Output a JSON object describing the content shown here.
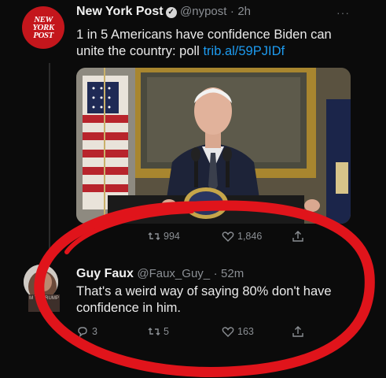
{
  "tweet1": {
    "avatar_text": [
      "NEW",
      "YORK",
      "POST"
    ],
    "name": "New York Post",
    "handle": "@nypost",
    "separator": "·",
    "time": "2h",
    "text": "1 in 5 Americans have confidence Biden can unite the country: poll",
    "link": "trib.al/59PJIDf",
    "more": "···",
    "metrics": {
      "retweets": "994",
      "likes": "1,846"
    }
  },
  "tweet2": {
    "avatar_badge": "M TO TRUMP",
    "name": "Guy Faux",
    "handle": "@Faux_Guy_",
    "separator": "·",
    "time": "52m",
    "text": "That's a weird way of saying 80% don't have confidence in him.",
    "metrics": {
      "replies": "3",
      "retweets": "5",
      "likes": "163"
    }
  },
  "colors": {
    "background": "#0b0b0b",
    "link": "#1d9bf0",
    "annotation_circle": "#e0141b",
    "nyp_red": "#c4161c"
  },
  "icons": [
    "verified-badge-icon",
    "more-icon",
    "retweet-icon",
    "like-icon",
    "share-icon",
    "reply-icon"
  ]
}
